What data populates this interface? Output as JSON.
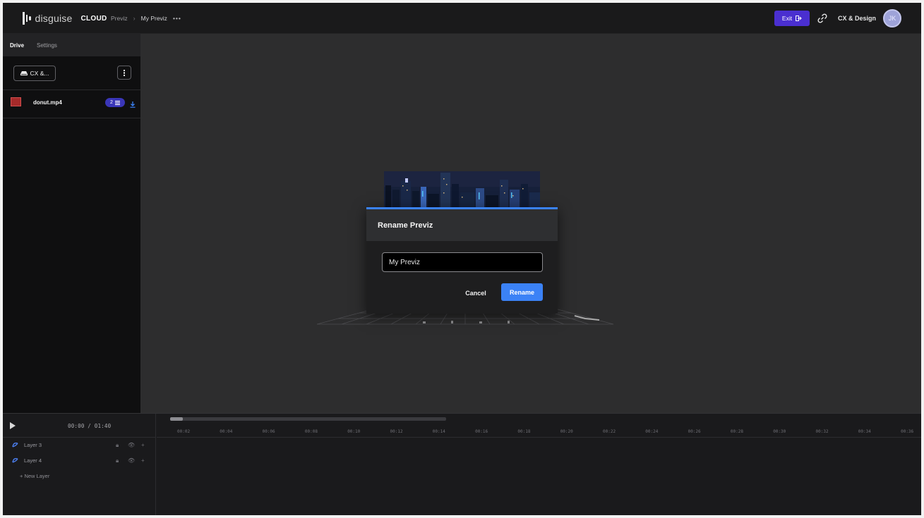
{
  "app": {
    "brand_word": "disguise",
    "brand_product": "CLOUD",
    "breadcrumb": {
      "parent": "Previz",
      "current": "My Previz",
      "more": "•••"
    }
  },
  "header": {
    "exit_label": "Exit",
    "org_name": "CX & Design",
    "avatar_initials": "JK"
  },
  "sidebar": {
    "tabs": [
      {
        "label": "Drive",
        "active": true
      },
      {
        "label": "Settings",
        "active": false
      }
    ],
    "drive_select_label": "CX &...",
    "files": [
      {
        "name": "donut.mp4",
        "badge_count": "2"
      }
    ]
  },
  "modal": {
    "title": "Rename Previz",
    "input_value": "My Previz",
    "cancel_label": "Cancel",
    "confirm_label": "Rename"
  },
  "timeline": {
    "time_readout": "00:00 / 01:40",
    "layers": [
      {
        "name": "Layer 3"
      },
      {
        "name": "Layer 4"
      }
    ],
    "new_layer_label": "+ New Layer",
    "ticks": [
      "00:02",
      "00:04",
      "00:06",
      "00:08",
      "00:10",
      "00:12",
      "00:14",
      "00:16",
      "00:18",
      "00:20",
      "00:22",
      "00:24",
      "00:26",
      "00:28",
      "00:30",
      "00:32",
      "00:34",
      "00:36"
    ]
  },
  "colors": {
    "accent_purple": "#4a2fd0",
    "accent_blue": "#3b82f6"
  }
}
